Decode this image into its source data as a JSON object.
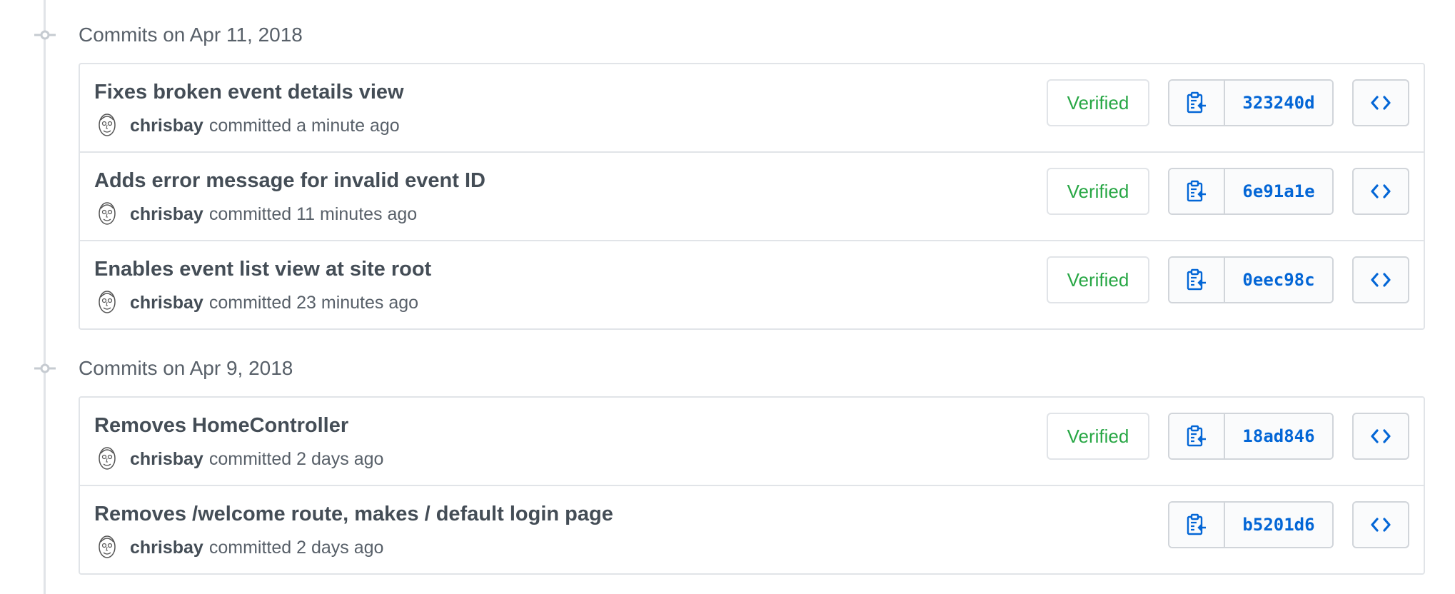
{
  "colors": {
    "verified": "#28a745",
    "link": "#0366d6",
    "border": "#e1e4e8",
    "muted": "#586069"
  },
  "groups": [
    {
      "title": "Commits on Apr 11, 2018",
      "commits": [
        {
          "message": "Fixes broken event details view",
          "author": "chrisbay",
          "action": "committed",
          "time": "a minute ago",
          "verified": "Verified",
          "sha": "323240d"
        },
        {
          "message": "Adds error message for invalid event ID",
          "author": "chrisbay",
          "action": "committed",
          "time": "11 minutes ago",
          "verified": "Verified",
          "sha": "6e91a1e"
        },
        {
          "message": "Enables event list view at site root",
          "author": "chrisbay",
          "action": "committed",
          "time": "23 minutes ago",
          "verified": "Verified",
          "sha": "0eec98c"
        }
      ]
    },
    {
      "title": "Commits on Apr 9, 2018",
      "commits": [
        {
          "message": "Removes HomeController",
          "author": "chrisbay",
          "action": "committed",
          "time": "2 days ago",
          "verified": "Verified",
          "sha": "18ad846"
        },
        {
          "message": "Removes /welcome route, makes / default login page",
          "author": "chrisbay",
          "action": "committed",
          "time": "2 days ago",
          "verified": "",
          "sha": "b5201d6"
        }
      ]
    }
  ],
  "icons": {
    "node": "git-commit-icon",
    "copy": "clippy-icon",
    "browse": "code-icon",
    "avatar": "avatar"
  }
}
